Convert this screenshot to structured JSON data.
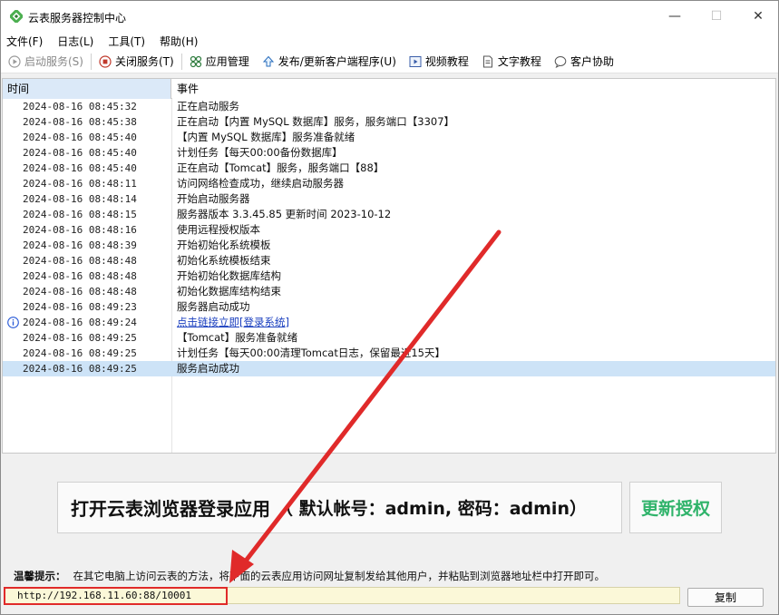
{
  "window": {
    "title": "云表服务器控制中心"
  },
  "window_controls": {
    "minimize": "—",
    "maximize": "☐",
    "close": "✕"
  },
  "menu": [
    "文件(F)",
    "日志(L)",
    "工具(T)",
    "帮助(H)"
  ],
  "toolbar": {
    "start": "启动服务(S)",
    "stop": "关闭服务(T)",
    "apps": "应用管理",
    "publish": "发布/更新客户端程序(U)",
    "video": "视频教程",
    "text": "文字教程",
    "support": "客户协助"
  },
  "table": {
    "col_time": "时间",
    "col_event": "事件",
    "rows": [
      {
        "time": "2024-08-16 08:45:32",
        "event": "正在启动服务"
      },
      {
        "time": "2024-08-16 08:45:38",
        "event": "正在启动【内置 MySQL 数据库】服务，服务端口【3307】"
      },
      {
        "time": "2024-08-16 08:45:40",
        "event": "【内置 MySQL 数据库】服务准备就绪"
      },
      {
        "time": "2024-08-16 08:45:40",
        "event": "计划任务【每天00:00备份数据库】"
      },
      {
        "time": "2024-08-16 08:45:40",
        "event": "正在启动【Tomcat】服务，服务端口【88】"
      },
      {
        "time": "2024-08-16 08:48:11",
        "event": "访问网络检查成功，继续启动服务器"
      },
      {
        "time": "2024-08-16 08:48:14",
        "event": "开始启动服务器"
      },
      {
        "time": "2024-08-16 08:48:15",
        "event": "服务器版本  3.3.45.85 更新时间 2023-10-12"
      },
      {
        "time": "2024-08-16 08:48:16",
        "event": "使用远程授权版本"
      },
      {
        "time": "2024-08-16 08:48:39",
        "event": "开始初始化系统模板"
      },
      {
        "time": "2024-08-16 08:48:48",
        "event": "初始化系统模板结束"
      },
      {
        "time": "2024-08-16 08:48:48",
        "event": "开始初始化数据库结构"
      },
      {
        "time": "2024-08-16 08:48:48",
        "event": "初始化数据库结构结束"
      },
      {
        "time": "2024-08-16 08:49:23",
        "event": "服务器启动成功"
      },
      {
        "time": "2024-08-16 08:49:24",
        "event": "点击链接立即[登录系统]",
        "link": true
      },
      {
        "time": "2024-08-16 08:49:25",
        "event": "【Tomcat】服务准备就绪"
      },
      {
        "time": "2024-08-16 08:49:25",
        "event": "计划任务【每天00:00清理Tomcat日志，保留最近15天】"
      },
      {
        "time": "2024-08-16 08:49:25",
        "event": "服务启动成功",
        "selected": true
      }
    ]
  },
  "open_app": {
    "label": "打开云表浏览器登录应用",
    "sub": "（ 默认帐号：admin, 密码：admin）"
  },
  "renew_label": "更新授权",
  "tip": {
    "label": "温馨提示：",
    "text": "在其它电脑上访问云表的方法，将下面的云表应用访问网址复制发给其他用户，并粘贴到浏览器地址栏中打开即可。"
  },
  "url": "http://192.168.11.60:88/10001",
  "copy_label": "复制",
  "colors": {
    "accent_green": "#2fb36a",
    "highlight_red": "#e02a2a",
    "selected_row": "#cde3f7",
    "link_blue": "#1a3fbf"
  }
}
